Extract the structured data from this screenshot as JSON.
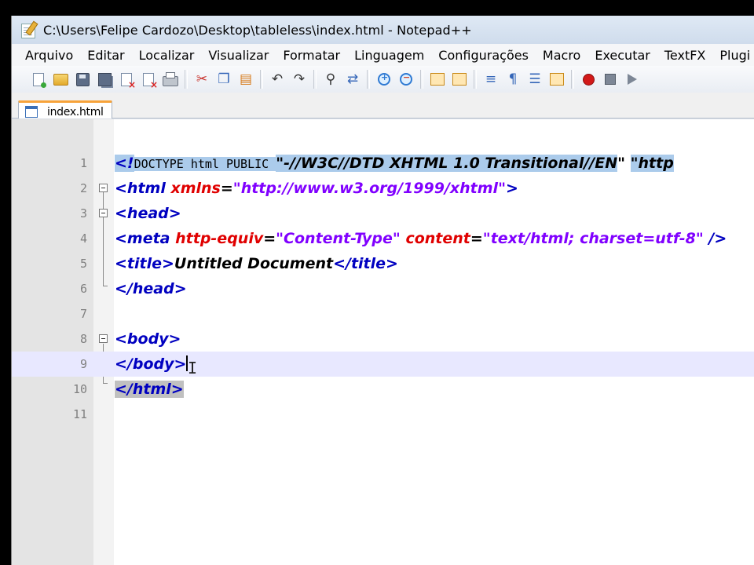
{
  "window": {
    "title": "C:\\Users\\Felipe Cardozo\\Desktop\\tableless\\index.html - Notepad++"
  },
  "menu": [
    "Arquivo",
    "Editar",
    "Localizar",
    "Visualizar",
    "Formatar",
    "Linguagem",
    "Configurações",
    "Macro",
    "Executar",
    "TextFX",
    "Plugi"
  ],
  "toolbar": {
    "icons": [
      "new-file-icon",
      "open-folder-icon",
      "save-icon",
      "save-all-icon",
      "close-file-icon",
      "close-all-icon",
      "print-icon",
      "cut-icon",
      "copy-icon",
      "paste-icon",
      "undo-icon",
      "redo-icon",
      "find-icon",
      "replace-icon",
      "zoom-in-icon",
      "zoom-out-icon",
      "sync-vertical-icon",
      "sync-horizontal-icon",
      "word-wrap-icon",
      "show-all-chars-icon",
      "indent-guide-icon",
      "user-defined-lang-icon",
      "record-macro-icon",
      "stop-macro-icon",
      "play-macro-icon"
    ]
  },
  "tab": {
    "label": "index.html"
  },
  "editor": {
    "line_numbers": [
      "1",
      "2",
      "3",
      "4",
      "5",
      "6",
      "7",
      "8",
      "9",
      "10",
      "11"
    ],
    "lines": {
      "l1": {
        "open": "<!",
        "kw": "DOCTYPE html PUBLIC ",
        "q1": "\"",
        "fpi": "-//W3C//DTD XHTML 1.0 Transitional//EN",
        "q2": "\" ",
        "q3": "\"",
        "url": "http"
      },
      "l2": {
        "tag_open": "<html ",
        "attr": "xmlns",
        "eq": "=",
        "val": "\"http://www.w3.org/1999/xhtml\"",
        "tag_close": ">"
      },
      "l3": {
        "tag": "<head>"
      },
      "l4": {
        "tag_open": "<meta ",
        "attr1": "http-equiv",
        "eq1": "=",
        "val1": "\"Content-Type\"",
        "sp": " ",
        "attr2": "content",
        "eq2": "=",
        "val2": "\"text/html; charset=utf-8\"",
        "tag_close": " />"
      },
      "l5": {
        "tag_open": "<title>",
        "text": "Untitled Document",
        "tag_close": "</title>"
      },
      "l6": {
        "tag": "</head>"
      },
      "l7": {
        "text": ""
      },
      "l8": {
        "tag": "<body>"
      },
      "l9": {
        "tag": "</body>"
      },
      "l10": {
        "tag": "</html>"
      },
      "l11": {
        "text": ""
      }
    }
  }
}
